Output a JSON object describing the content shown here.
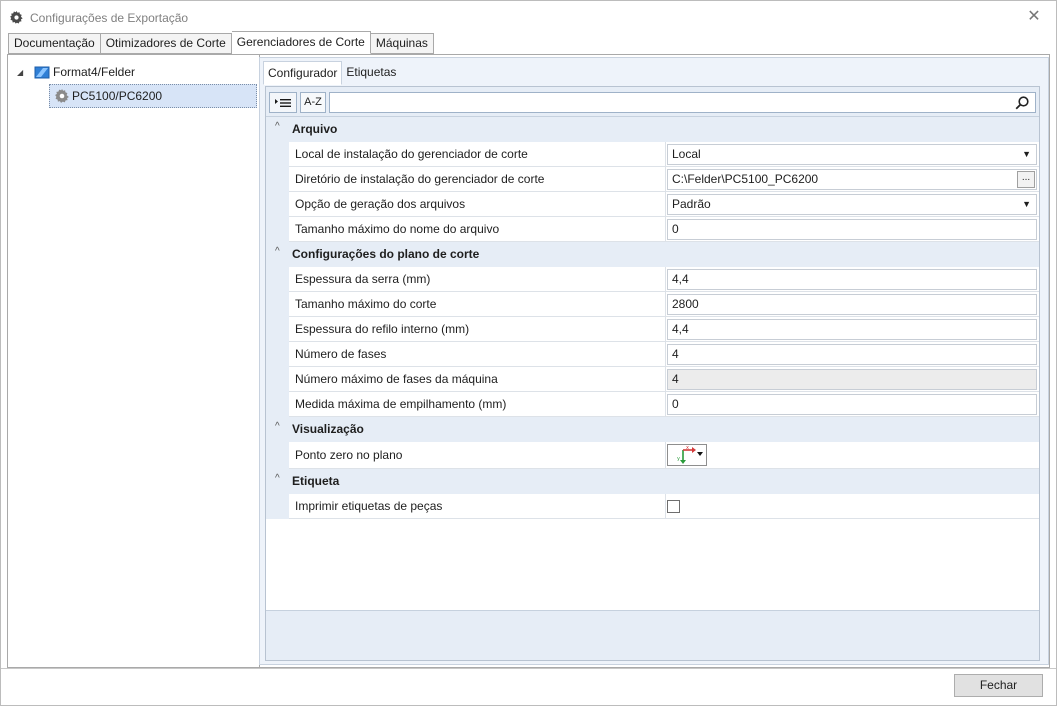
{
  "window": {
    "title": "Configurações de Exportação",
    "close_symbol": "✕"
  },
  "main_tabs": [
    {
      "label": "Documentação",
      "active": false
    },
    {
      "label": "Otimizadores de Corte",
      "active": false
    },
    {
      "label": "Gerenciadores de Corte",
      "active": true
    },
    {
      "label": "Máquinas",
      "active": false
    }
  ],
  "tree": {
    "root": {
      "label": "Format4/Felder",
      "icon": "software-icon"
    },
    "child": {
      "label": "PC5100/PC6200",
      "icon": "gear-icon",
      "selected": true
    }
  },
  "sub_tabs": [
    {
      "label": "Configurador",
      "active": true
    },
    {
      "label": "Etiquetas",
      "active": false
    }
  ],
  "toolbar": {
    "sort_categorized": "categorized-sort-icon",
    "sort_az_label": "A-Z",
    "search_value": ""
  },
  "categories": [
    {
      "label": "Arquivo",
      "properties": [
        {
          "name": "Local de instalação do gerenciador de corte",
          "value": "Local",
          "kind": "dropdown"
        },
        {
          "name": "Diretório de instalação do gerenciador de corte",
          "value": "C:\\Felder\\PC5100_PC6200",
          "kind": "browse"
        },
        {
          "name": "Opção de geração dos arquivos",
          "value": "Padrão",
          "kind": "dropdown"
        },
        {
          "name": "Tamanho máximo do nome do arquivo",
          "value": "0",
          "kind": "text"
        }
      ]
    },
    {
      "label": "Configurações do plano de corte",
      "properties": [
        {
          "name": "Espessura da serra (mm)",
          "value": "4,4",
          "kind": "text"
        },
        {
          "name": "Tamanho máximo do corte",
          "value": "2800",
          "kind": "text"
        },
        {
          "name": "Espessura do refilo interno (mm)",
          "value": "4,4",
          "kind": "text"
        },
        {
          "name": "Número de fases",
          "value": "4",
          "kind": "text"
        },
        {
          "name": "Número máximo de fases da máquina",
          "value": "4",
          "kind": "readonly"
        },
        {
          "name": "Medida máxima de empilhamento (mm)",
          "value": "0",
          "kind": "text"
        }
      ]
    },
    {
      "label": "Visualização",
      "properties": [
        {
          "name": "Ponto zero no plano",
          "value": "",
          "kind": "origin"
        }
      ]
    },
    {
      "label": "Etiqueta",
      "properties": [
        {
          "name": "Imprimir etiquetas de peças",
          "value": false,
          "kind": "checkbox"
        }
      ]
    }
  ],
  "footer": {
    "close_label": "Fechar"
  },
  "colors": {
    "accent_selection": "#d7e4f7",
    "panel_bg": "#eef3fa",
    "category_bg": "#e6edf6"
  }
}
